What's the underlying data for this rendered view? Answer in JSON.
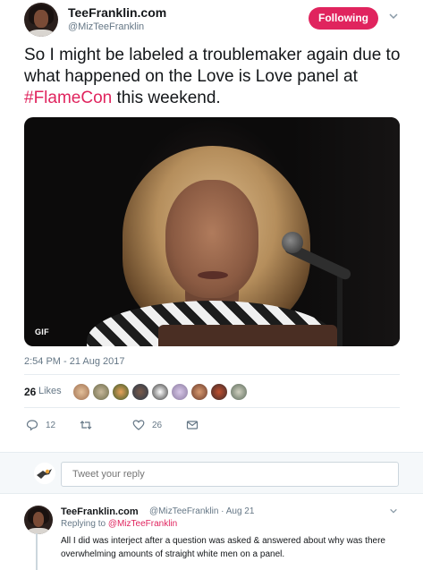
{
  "author": {
    "display_name": "TeeFranklin.com",
    "handle": "@MizTeeFranklin",
    "follow_label": "Following"
  },
  "tweet": {
    "text_before": "So I might be labeled a troublemaker again due to what happened on the Love is Love panel at ",
    "hashtag": "#FlameCon",
    "text_after": " this weekend.",
    "media_badge": "GIF",
    "timestamp": "2:54 PM - 21 Aug 2017"
  },
  "likes": {
    "count": "26",
    "label": "Likes",
    "avatars": [
      "liker-avatar-1",
      "liker-avatar-2",
      "liker-avatar-3",
      "liker-avatar-4",
      "liker-avatar-5",
      "liker-avatar-6",
      "liker-avatar-7",
      "liker-avatar-8",
      "liker-avatar-9"
    ]
  },
  "actions": {
    "reply_count": "12",
    "retweet_count": "",
    "like_count": "26"
  },
  "reply_box": {
    "placeholder": "Tweet your reply"
  },
  "reply": {
    "display_name": "TeeFranklin.com",
    "meta": "@MizTeeFranklin · Aug 21",
    "replying_to_label": "Replying to ",
    "replying_to_handle": "@MizTeeFranklin",
    "body": "All I did was interject after a question was asked & answered about why was there overwhelming amounts of straight white men on a panel."
  },
  "colors": {
    "accent": "#e0245e",
    "muted": "#657786",
    "divider": "#e6ecf0"
  },
  "icons": [
    "chevron-down-icon",
    "reply-icon",
    "retweet-icon",
    "heart-icon",
    "envelope-icon"
  ]
}
